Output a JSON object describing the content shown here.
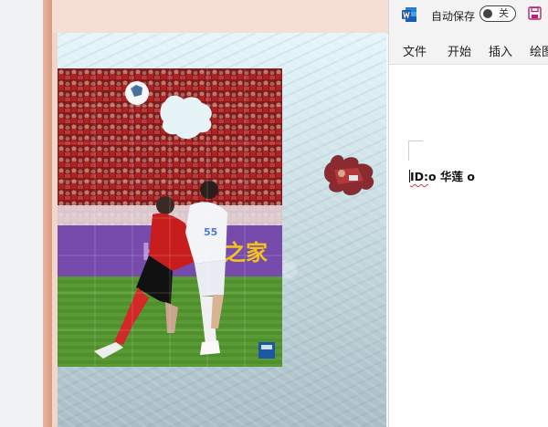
{
  "word_window": {
    "autosave_label": "自动保存",
    "autosave_state": "关",
    "tabs": [
      "文件",
      "开始",
      "插入",
      "绘图"
    ],
    "document_text_prefix": "ID:",
    "document_text_rest": "o 华莲 o"
  },
  "puzzle": {
    "photo_subject": "football players challenging for a header",
    "banner_text": "H 之家",
    "player_number_white": "55",
    "colors": {
      "red_kit": "#c81d1d",
      "white_kit": "#f2f4f8",
      "pitch": "#4f8f2e",
      "banner": "#6b3fa0"
    }
  },
  "colors": {
    "accent_frame": "#d99a7f",
    "word_blue": "#2b579a",
    "save_purple": "#a4373a"
  }
}
